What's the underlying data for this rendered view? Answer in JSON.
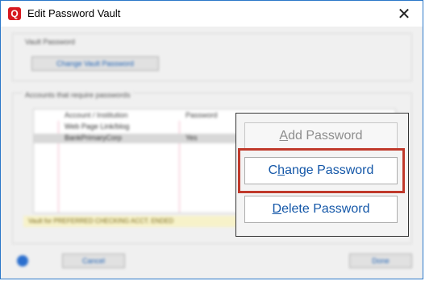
{
  "window": {
    "title": "Edit Password Vault",
    "app_icon_letter": "Q",
    "close_glyph": "✕"
  },
  "background": {
    "vault_group_label": "Vault Password",
    "change_vault_button": "Change Vault Password",
    "accounts_group_label": "Accounts that require passwords",
    "table_headers": [
      "Account / Institution",
      "Password"
    ],
    "rows": [
      {
        "name": "Web Page Link/blog",
        "status": ""
      },
      {
        "name": "BankPrimaryCorp",
        "status": "Yes"
      }
    ],
    "status_strip": "Vault for PREFERRED CHECKING ACCT. ENDED",
    "cancel_button": "Cancel",
    "done_button": "Done"
  },
  "popup": {
    "add": {
      "pre": "",
      "accel": "A",
      "post": "dd Password"
    },
    "change": {
      "pre": "C",
      "accel": "h",
      "post": "ange Password"
    },
    "delete": {
      "pre": "",
      "accel": "D",
      "post": "elete Password"
    }
  },
  "colors": {
    "accent": "#1457a8",
    "highlight": "#c0392b",
    "brand": "#d71920"
  }
}
